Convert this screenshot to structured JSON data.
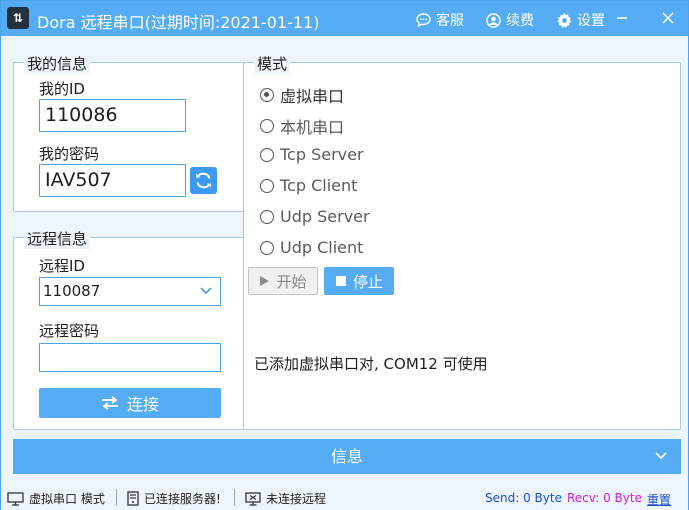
{
  "window": {
    "title": "Dora 远程串口(过期时间:2021-01-11)",
    "actions": {
      "support": "客服",
      "renew": "续费",
      "settings": "设置"
    }
  },
  "my_info": {
    "legend": "我的信息",
    "id_label": "我的ID",
    "id_value": "110086",
    "password_label": "我的密码",
    "password_value": "IAV507"
  },
  "remote_info": {
    "legend": "远程信息",
    "id_label": "远程ID",
    "id_value": "110087",
    "password_label": "远程密码",
    "password_value": "",
    "connect_label": "连接"
  },
  "mode": {
    "legend": "模式",
    "options": [
      {
        "label": "虚拟串口",
        "checked": true
      },
      {
        "label": "本机串口",
        "checked": false
      },
      {
        "label": "Tcp Server",
        "checked": false
      },
      {
        "label": "Tcp Client",
        "checked": false
      },
      {
        "label": "Udp Server",
        "checked": false
      },
      {
        "label": "Udp Client",
        "checked": false
      }
    ],
    "start_label": "开始",
    "stop_label": "停止",
    "message": "已添加虚拟串口对, COM12 可使用"
  },
  "info_bar": {
    "label": "信息"
  },
  "statusbar": {
    "mode": "虚拟串口 模式",
    "server": "已连接服务器!",
    "remote": "未连接远程",
    "send": "Send: 0 Byte",
    "recv": "Recv: 0 Byte",
    "reset": "重置"
  },
  "colors": {
    "accent": "#55acf5",
    "border": "#4ea4ec",
    "send": "#1c4fd8",
    "recv": "#d41fd4"
  }
}
